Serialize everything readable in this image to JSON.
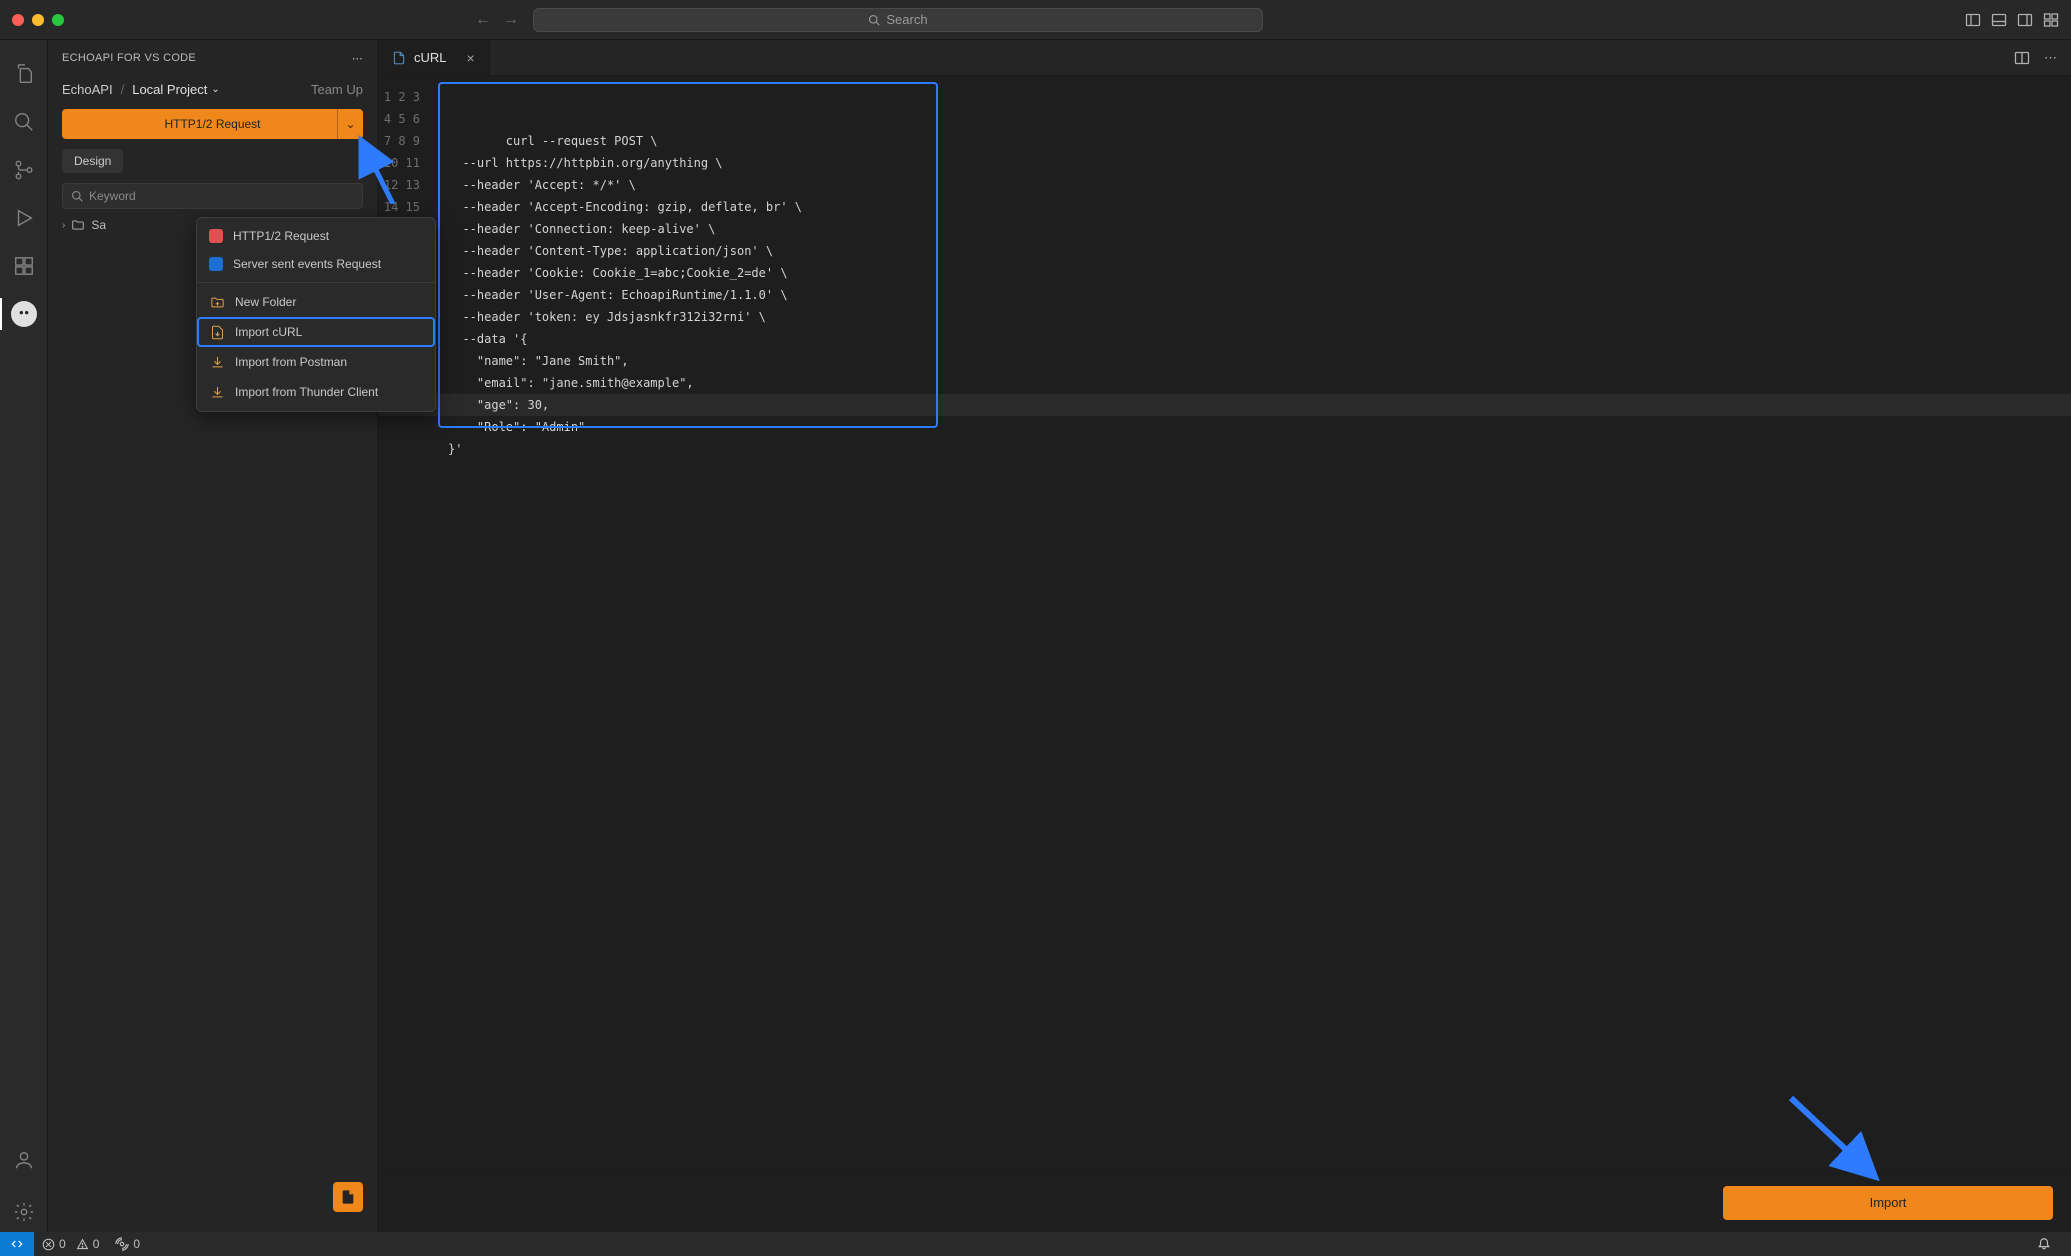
{
  "titlebar": {
    "search_placeholder": "Search"
  },
  "sidebar": {
    "title": "ECHOAPI FOR VS CODE",
    "breadcrumb_root": "EchoAPI",
    "breadcrumb_project": "Local Project",
    "teamup": "Team Up",
    "main_button": "HTTP1/2 Request",
    "tab_design": "Design",
    "search_placeholder": "Keyword",
    "tree_sample": "Sa"
  },
  "dropdown": {
    "items": [
      {
        "label": "HTTP1/2 Request",
        "icon": "http-icon"
      },
      {
        "label": "Server sent events Request",
        "icon": "sse-icon"
      },
      {
        "label": "New Folder",
        "icon": "folder-icon"
      },
      {
        "label": "Import cURL",
        "icon": "import-curl-icon",
        "highlight": true
      },
      {
        "label": "Import from Postman",
        "icon": "import-postman-icon"
      },
      {
        "label": "Import from Thunder Client",
        "icon": "import-thunder-icon"
      }
    ]
  },
  "editor": {
    "tab_title": "cURL",
    "lines": [
      "curl --request POST \\",
      "  --url https://httpbin.org/anything \\",
      "  --header 'Accept: */*' \\",
      "  --header 'Accept-Encoding: gzip, deflate, br' \\",
      "  --header 'Connection: keep-alive' \\",
      "  --header 'Content-Type: application/json' \\",
      "  --header 'Cookie: Cookie_1=abc;Cookie_2=de' \\",
      "  --header 'User-Agent: EchoapiRuntime/1.1.0' \\",
      "  --header 'token: ey Jdsjasnkfr312i32rni' \\",
      "  --data '{",
      "    \"name\": \"Jane Smith\",",
      "    \"email\": \"jane.smith@example\",",
      "    \"age\": 30,",
      "    \"Role\": \"Admin\"",
      "}'"
    ],
    "line_numbers": [
      "1",
      "2",
      "3",
      "4",
      "5",
      "6",
      "7",
      "8",
      "9",
      "10",
      "11",
      "12",
      "13",
      "14",
      "15"
    ]
  },
  "bottom": {
    "import_label": "Import"
  },
  "statusbar": {
    "errors": "0",
    "warnings": "0",
    "ports": "0"
  }
}
